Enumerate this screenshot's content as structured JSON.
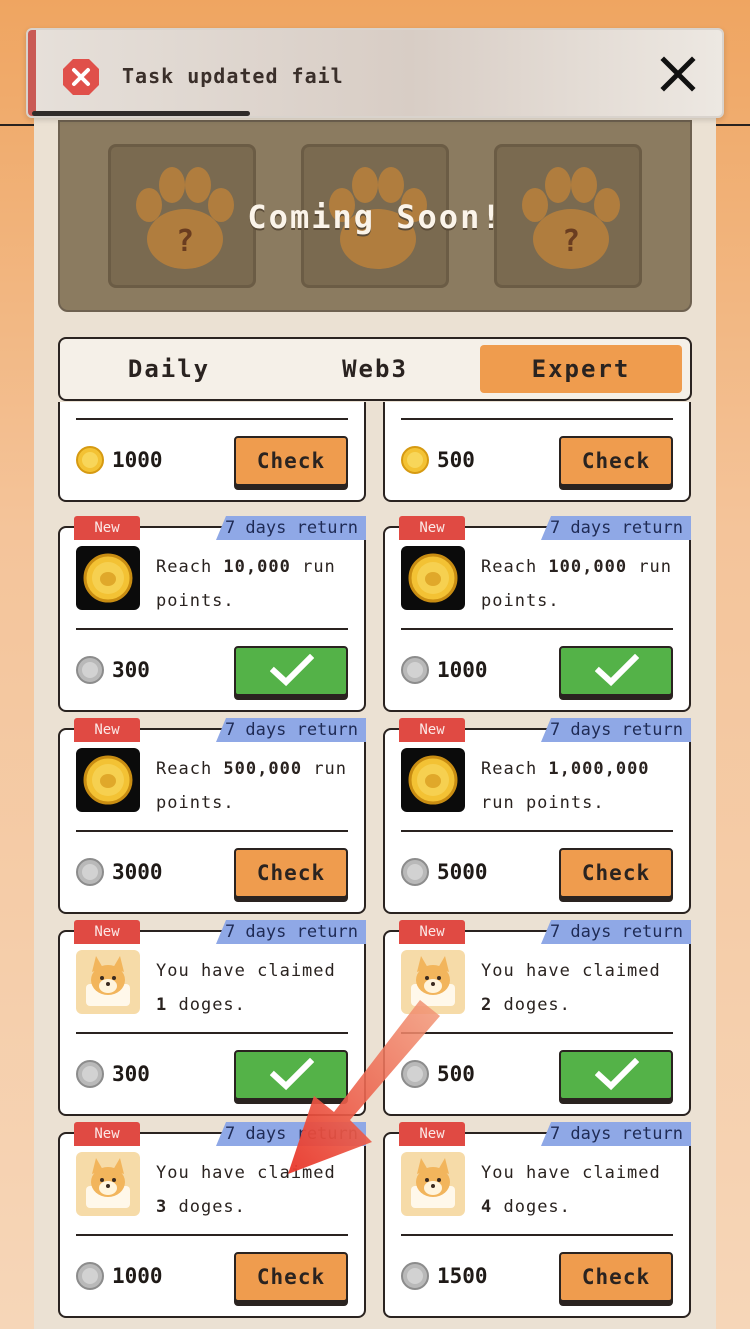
{
  "toast": {
    "message": "Task updated fail"
  },
  "banner": {
    "coming_soon": "Coming Soon!"
  },
  "tabs": [
    {
      "label": "Daily",
      "active": false
    },
    {
      "label": "Web3",
      "active": false
    },
    {
      "label": "Expert",
      "active": true
    }
  ],
  "tasks": [
    {
      "reward": "1000",
      "reward_coin": "gold",
      "status": "check",
      "button_label": "Check"
    },
    {
      "reward": "500",
      "reward_coin": "gold",
      "status": "check",
      "button_label": "Check"
    },
    {
      "new_tag": "New",
      "return_tag": "7 days return",
      "desc_prefix": "Reach ",
      "desc_bold": "10,000",
      "desc_suffix": " run points.",
      "icon": "gold-coin",
      "reward": "300",
      "reward_coin": "silver",
      "status": "done"
    },
    {
      "new_tag": "New",
      "return_tag": "7 days return",
      "desc_prefix": "Reach ",
      "desc_bold": "100,000",
      "desc_suffix": " run points.",
      "icon": "gold-coin",
      "reward": "1000",
      "reward_coin": "silver",
      "status": "done"
    },
    {
      "new_tag": "New",
      "return_tag": "7 days return",
      "desc_prefix": "Reach ",
      "desc_bold": "500,000",
      "desc_suffix": " run points.",
      "icon": "gold-coin",
      "reward": "3000",
      "reward_coin": "silver",
      "status": "check",
      "button_label": "Check"
    },
    {
      "new_tag": "New",
      "return_tag": "7 days return",
      "desc_prefix": "Reach ",
      "desc_bold": "1,000,000",
      "desc_suffix": " run points.",
      "icon": "gold-coin",
      "reward": "5000",
      "reward_coin": "silver",
      "status": "check",
      "button_label": "Check"
    },
    {
      "new_tag": "New",
      "return_tag": "7 days return",
      "desc_prefix": "You have claimed ",
      "desc_bold": "1",
      "desc_suffix": " doges.",
      "icon": "doge",
      "reward": "300",
      "reward_coin": "silver",
      "status": "done"
    },
    {
      "new_tag": "New",
      "return_tag": "7 days return",
      "desc_prefix": "You have claimed ",
      "desc_bold": "2",
      "desc_suffix": " doges.",
      "icon": "doge",
      "reward": "500",
      "reward_coin": "silver",
      "status": "done"
    },
    {
      "new_tag": "New",
      "return_tag": "7 days return",
      "desc_prefix": "You have claimed ",
      "desc_bold": "3",
      "desc_suffix": " doges.",
      "icon": "doge",
      "reward": "1000",
      "reward_coin": "silver",
      "status": "check",
      "button_label": "Check"
    },
    {
      "new_tag": "New",
      "return_tag": "7 days return",
      "desc_prefix": "You have claimed ",
      "desc_bold": "4",
      "desc_suffix": " doges.",
      "icon": "doge",
      "reward": "1500",
      "reward_coin": "silver",
      "status": "check",
      "button_label": "Check"
    }
  ]
}
